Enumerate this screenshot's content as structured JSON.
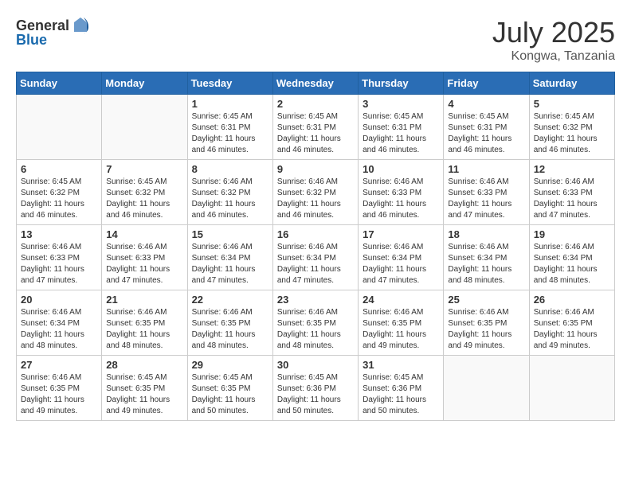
{
  "header": {
    "logo_general": "General",
    "logo_blue": "Blue",
    "month_year": "July 2025",
    "location": "Kongwa, Tanzania"
  },
  "days_of_week": [
    "Sunday",
    "Monday",
    "Tuesday",
    "Wednesday",
    "Thursday",
    "Friday",
    "Saturday"
  ],
  "weeks": [
    [
      {
        "day": "",
        "info": ""
      },
      {
        "day": "",
        "info": ""
      },
      {
        "day": "1",
        "info": "Sunrise: 6:45 AM\nSunset: 6:31 PM\nDaylight: 11 hours and 46 minutes."
      },
      {
        "day": "2",
        "info": "Sunrise: 6:45 AM\nSunset: 6:31 PM\nDaylight: 11 hours and 46 minutes."
      },
      {
        "day": "3",
        "info": "Sunrise: 6:45 AM\nSunset: 6:31 PM\nDaylight: 11 hours and 46 minutes."
      },
      {
        "day": "4",
        "info": "Sunrise: 6:45 AM\nSunset: 6:31 PM\nDaylight: 11 hours and 46 minutes."
      },
      {
        "day": "5",
        "info": "Sunrise: 6:45 AM\nSunset: 6:32 PM\nDaylight: 11 hours and 46 minutes."
      }
    ],
    [
      {
        "day": "6",
        "info": "Sunrise: 6:45 AM\nSunset: 6:32 PM\nDaylight: 11 hours and 46 minutes."
      },
      {
        "day": "7",
        "info": "Sunrise: 6:45 AM\nSunset: 6:32 PM\nDaylight: 11 hours and 46 minutes."
      },
      {
        "day": "8",
        "info": "Sunrise: 6:46 AM\nSunset: 6:32 PM\nDaylight: 11 hours and 46 minutes."
      },
      {
        "day": "9",
        "info": "Sunrise: 6:46 AM\nSunset: 6:32 PM\nDaylight: 11 hours and 46 minutes."
      },
      {
        "day": "10",
        "info": "Sunrise: 6:46 AM\nSunset: 6:33 PM\nDaylight: 11 hours and 46 minutes."
      },
      {
        "day": "11",
        "info": "Sunrise: 6:46 AM\nSunset: 6:33 PM\nDaylight: 11 hours and 47 minutes."
      },
      {
        "day": "12",
        "info": "Sunrise: 6:46 AM\nSunset: 6:33 PM\nDaylight: 11 hours and 47 minutes."
      }
    ],
    [
      {
        "day": "13",
        "info": "Sunrise: 6:46 AM\nSunset: 6:33 PM\nDaylight: 11 hours and 47 minutes."
      },
      {
        "day": "14",
        "info": "Sunrise: 6:46 AM\nSunset: 6:33 PM\nDaylight: 11 hours and 47 minutes."
      },
      {
        "day": "15",
        "info": "Sunrise: 6:46 AM\nSunset: 6:34 PM\nDaylight: 11 hours and 47 minutes."
      },
      {
        "day": "16",
        "info": "Sunrise: 6:46 AM\nSunset: 6:34 PM\nDaylight: 11 hours and 47 minutes."
      },
      {
        "day": "17",
        "info": "Sunrise: 6:46 AM\nSunset: 6:34 PM\nDaylight: 11 hours and 47 minutes."
      },
      {
        "day": "18",
        "info": "Sunrise: 6:46 AM\nSunset: 6:34 PM\nDaylight: 11 hours and 48 minutes."
      },
      {
        "day": "19",
        "info": "Sunrise: 6:46 AM\nSunset: 6:34 PM\nDaylight: 11 hours and 48 minutes."
      }
    ],
    [
      {
        "day": "20",
        "info": "Sunrise: 6:46 AM\nSunset: 6:34 PM\nDaylight: 11 hours and 48 minutes."
      },
      {
        "day": "21",
        "info": "Sunrise: 6:46 AM\nSunset: 6:35 PM\nDaylight: 11 hours and 48 minutes."
      },
      {
        "day": "22",
        "info": "Sunrise: 6:46 AM\nSunset: 6:35 PM\nDaylight: 11 hours and 48 minutes."
      },
      {
        "day": "23",
        "info": "Sunrise: 6:46 AM\nSunset: 6:35 PM\nDaylight: 11 hours and 48 minutes."
      },
      {
        "day": "24",
        "info": "Sunrise: 6:46 AM\nSunset: 6:35 PM\nDaylight: 11 hours and 49 minutes."
      },
      {
        "day": "25",
        "info": "Sunrise: 6:46 AM\nSunset: 6:35 PM\nDaylight: 11 hours and 49 minutes."
      },
      {
        "day": "26",
        "info": "Sunrise: 6:46 AM\nSunset: 6:35 PM\nDaylight: 11 hours and 49 minutes."
      }
    ],
    [
      {
        "day": "27",
        "info": "Sunrise: 6:46 AM\nSunset: 6:35 PM\nDaylight: 11 hours and 49 minutes."
      },
      {
        "day": "28",
        "info": "Sunrise: 6:45 AM\nSunset: 6:35 PM\nDaylight: 11 hours and 49 minutes."
      },
      {
        "day": "29",
        "info": "Sunrise: 6:45 AM\nSunset: 6:35 PM\nDaylight: 11 hours and 50 minutes."
      },
      {
        "day": "30",
        "info": "Sunrise: 6:45 AM\nSunset: 6:36 PM\nDaylight: 11 hours and 50 minutes."
      },
      {
        "day": "31",
        "info": "Sunrise: 6:45 AM\nSunset: 6:36 PM\nDaylight: 11 hours and 50 minutes."
      },
      {
        "day": "",
        "info": ""
      },
      {
        "day": "",
        "info": ""
      }
    ]
  ]
}
